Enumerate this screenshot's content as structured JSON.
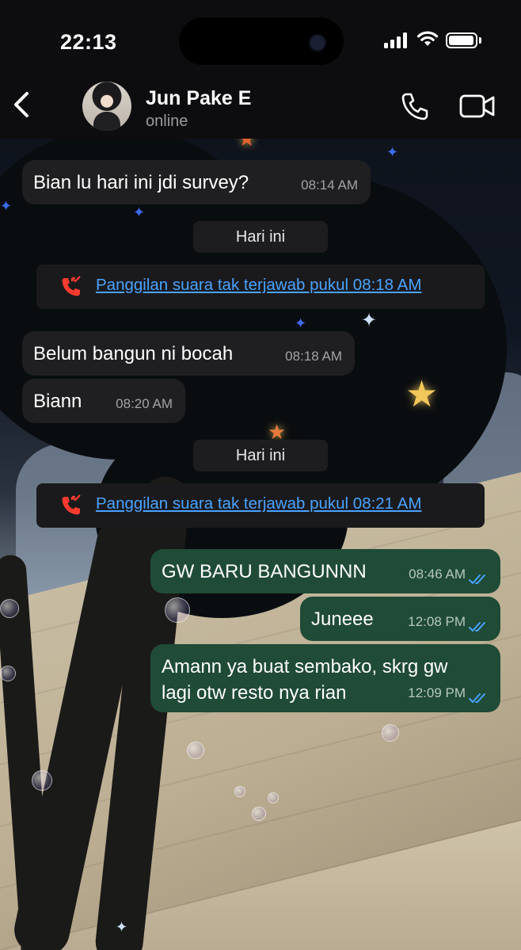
{
  "status_bar": {
    "time": "22:13"
  },
  "header": {
    "contact_name": "Jun Pake E",
    "presence": "online"
  },
  "icons": {
    "back": "chevron-left-icon",
    "call": "phone-icon",
    "video": "video-camera-icon",
    "missed_call": "missed-call-icon",
    "read_receipt": "double-check-icon"
  },
  "colors": {
    "incoming_bubble": "#1f1f21",
    "outgoing_bubble": "#1f4b37",
    "link": "#4aa3ff",
    "missed_call": "#ff3b30",
    "read_tick": "#4aa3ff"
  },
  "chat": {
    "m1": {
      "text": "Bian lu hari ini jdi survey?",
      "time": "08:14 AM"
    },
    "day1": "Hari ini",
    "call1": "Panggilan suara tak terjawab pukul 08:18 AM",
    "m2": {
      "text": "Belum bangun ni bocah",
      "time": "08:18 AM"
    },
    "m3": {
      "text": "Biann",
      "time": "08:20 AM"
    },
    "day2": "Hari ini",
    "call2": "Panggilan suara tak terjawab pukul 08:21 AM",
    "m4": {
      "text": "GW BARU BANGUNNN",
      "time": "08:46 AM"
    },
    "m5": {
      "text": "Juneee",
      "time": "12:08 PM"
    },
    "m6": {
      "text": "Amann ya buat sembako, skrg gw\nlagi otw resto nya rian",
      "time": "12:09 PM"
    }
  }
}
